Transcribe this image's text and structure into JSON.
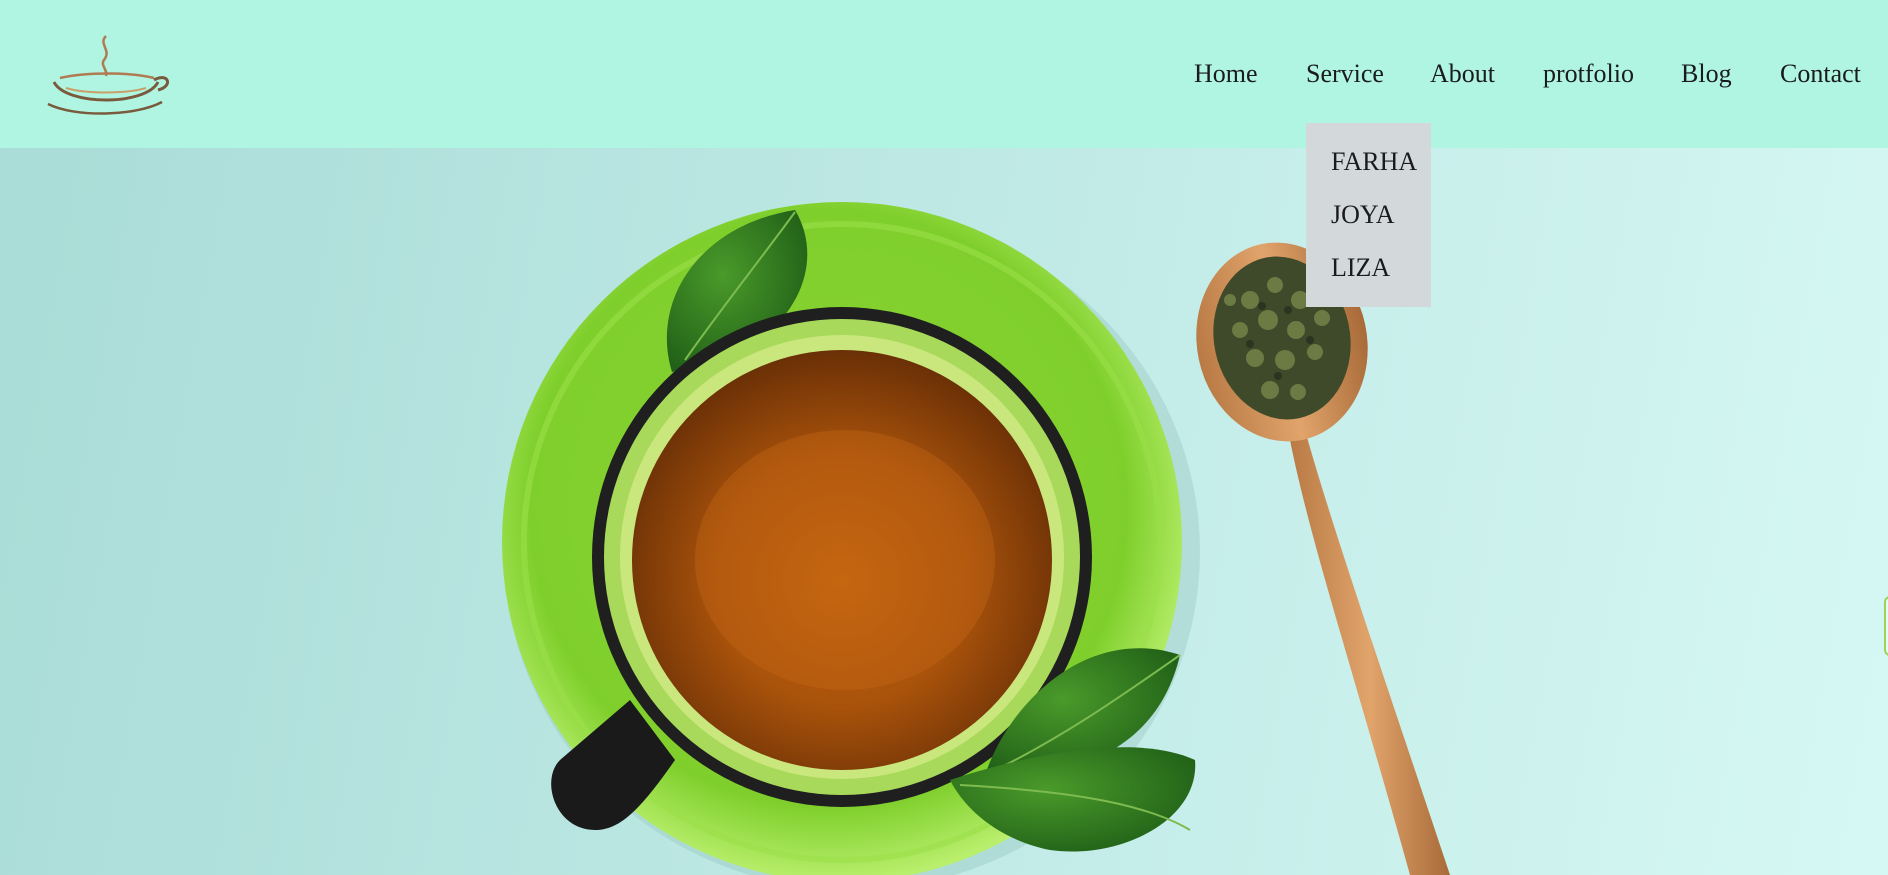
{
  "brand": {
    "logo_icon": "tea-cup-logo-icon"
  },
  "nav": {
    "items": [
      {
        "label": "Home"
      },
      {
        "label": "Service"
      },
      {
        "label": "About"
      },
      {
        "label": "protfolio"
      },
      {
        "label": "Blog"
      },
      {
        "label": "Contact"
      }
    ]
  },
  "service_dropdown": {
    "items": [
      {
        "label": "FARHA"
      },
      {
        "label": "JOYA"
      },
      {
        "label": "LIZA"
      }
    ]
  },
  "hero": {
    "image_icon": "green-tea-cup-with-spoon-icon"
  },
  "colors": {
    "header_bg": "#aff5e2",
    "dropdown_bg": "#d3d9db",
    "text": "#1b1b1b"
  }
}
